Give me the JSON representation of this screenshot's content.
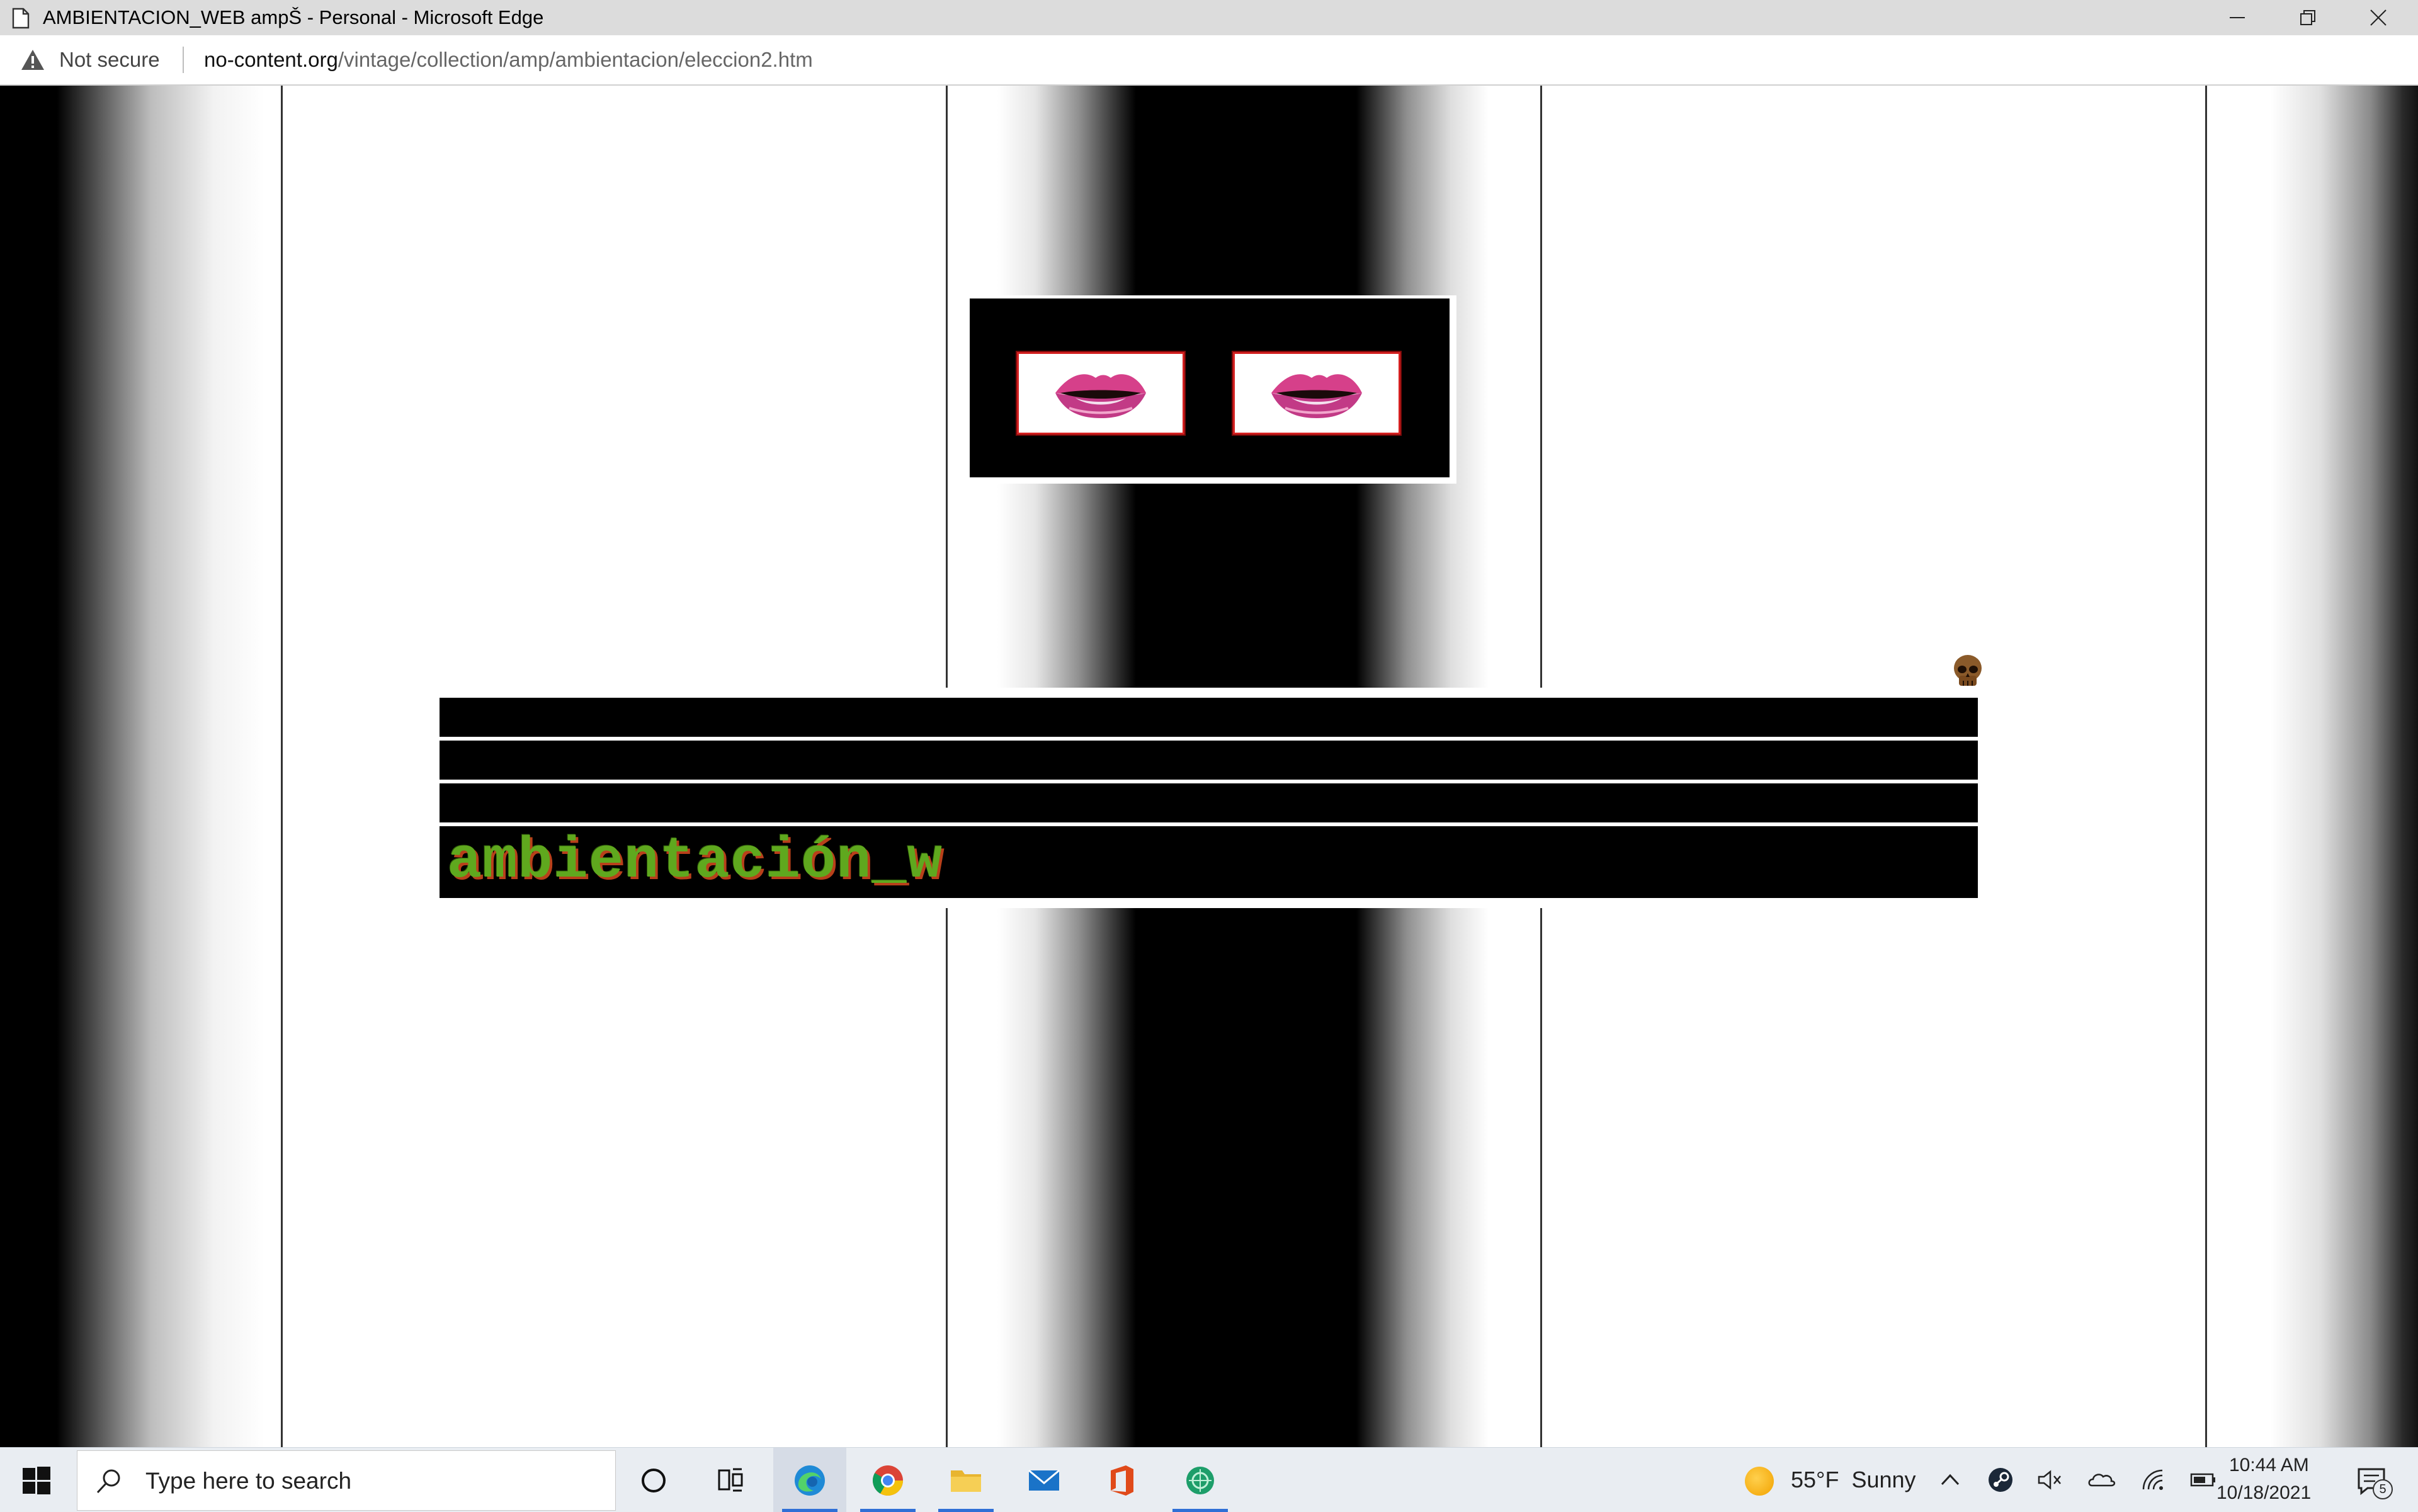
{
  "window": {
    "title": "AMBIENTACION_WEB ampŠ - Personal - Microsoft Edge",
    "controls": [
      "minimize",
      "restore",
      "close"
    ]
  },
  "addressbar": {
    "security_label": "Not secure",
    "url_host": "no-content.org",
    "url_path": "/vintage/collection/amp/ambientacion/eleccion2.htm"
  },
  "page": {
    "marquee_text": "ambientación_w",
    "images": [
      "lips-image",
      "lips-image",
      "skull-icon"
    ],
    "colors": {
      "marquee_fill": "#5fa81e",
      "marquee_shadow": "#b8401a",
      "tile_border": "#d42020",
      "background_dark": "#000000"
    }
  },
  "taskbar": {
    "search_placeholder": "Type here to search",
    "pinned_apps": [
      "cortana-icon",
      "task-view-icon",
      "edge-icon",
      "chrome-icon",
      "file-explorer-icon",
      "mail-icon",
      "office-icon",
      "app-icon"
    ],
    "weather": {
      "temp": "55°F",
      "condition": "Sunny"
    },
    "tray_icons": [
      "chevron-up-icon",
      "steam-icon",
      "volume-muted-icon",
      "onedrive-icon",
      "wifi-icon",
      "battery-icon"
    ],
    "clock": {
      "time": "10:44 AM",
      "date": "10/18/2021"
    },
    "notification_count": "5"
  }
}
